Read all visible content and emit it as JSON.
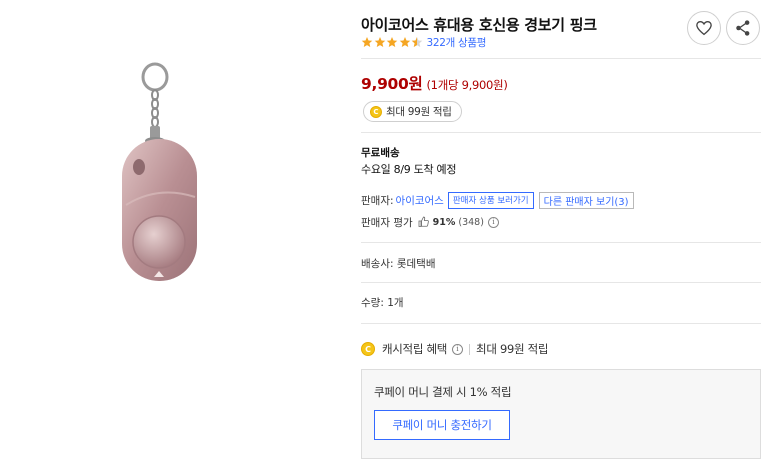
{
  "product": {
    "title": "아이코어스 휴대용 호신용 경보기 핑크",
    "rating": 4.5,
    "review_count": "322개 상품평",
    "image": "pink-personal-alarm-keychain"
  },
  "actions": {
    "wishlist_icon": "heart-icon",
    "share_icon": "share-icon"
  },
  "price": {
    "amount": "9,900원",
    "unit_price": "(1개당 9,900원)",
    "cash_badge": "최대 99원 적립"
  },
  "shipping": {
    "label": "무료배송",
    "arrival": "수요일 8/9 도착 예정"
  },
  "seller": {
    "label": "판매자:",
    "name": "아이코어스",
    "products_button": "판매자 상품 보러가기",
    "other_sellers_button": "다른 판매자 보기(3)",
    "rating_label": "판매자 평가",
    "rating_pct": "91%",
    "rating_count": "(348)"
  },
  "carrier": "배송사: 롯데택배",
  "quantity": "수량: 1개",
  "cash_benefit": {
    "label": "캐시적립 혜택",
    "value": "최대 99원 적립"
  },
  "coupay_money": {
    "text": "쿠페이 머니 결제 시 1% 적립",
    "button": "쿠페이 머니 충전하기"
  },
  "colors": {
    "price": "#ae0000",
    "link": "#346aff",
    "star": "#f5a623",
    "coin": "#f5c518"
  }
}
